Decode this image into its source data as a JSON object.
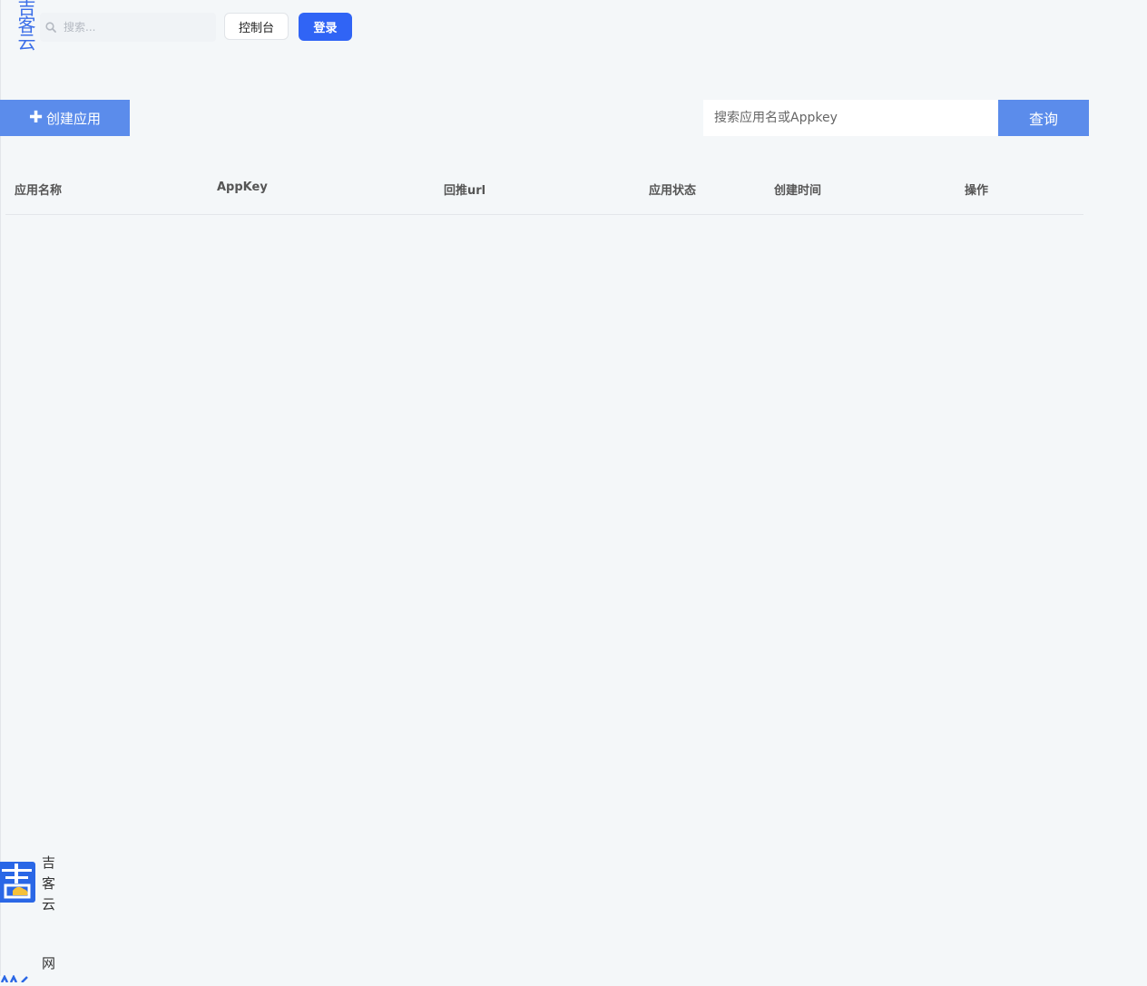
{
  "header": {
    "logo_text": "吉客云",
    "search_placeholder": "搜索...",
    "console_label": "控制台",
    "login_label": "登录"
  },
  "toolbar": {
    "create_label": "创建应用",
    "search_placeholder": "搜索应用名或Appkey",
    "query_label": "查询"
  },
  "table": {
    "columns": [
      "应用名称",
      "AppKey",
      "回推url",
      "应用状态",
      "创建时间",
      "操作"
    ],
    "rows": []
  },
  "footer": {
    "logo_text": "吉客云",
    "extra_text": "网"
  },
  "colors": {
    "primary": "#5b8ceb",
    "login": "#3064f5",
    "background": "#f4f7f9"
  }
}
